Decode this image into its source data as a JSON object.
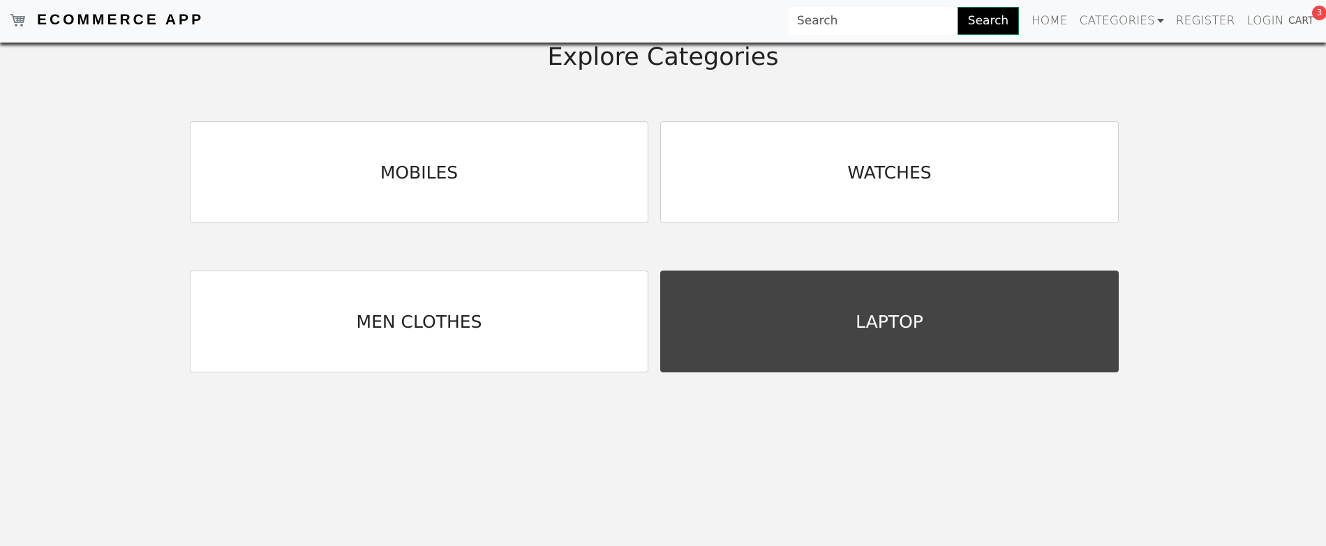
{
  "navbar": {
    "brand_icon": "shopping-cart-icon",
    "brand_text": "ECOMMERCE APP",
    "search": {
      "placeholder": "Search",
      "value": "",
      "button_label": "Search"
    },
    "links": {
      "home": "HOME",
      "categories": "CATEGORIES",
      "register": "REGISTER",
      "login": "LOGIN",
      "cart": "CART"
    },
    "cart_count": "3"
  },
  "main": {
    "title": "Explore Categories",
    "categories": [
      {
        "label": "MOBILES",
        "active": false
      },
      {
        "label": "WATCHES",
        "active": false
      },
      {
        "label": "MEN CLOTHES",
        "active": false
      },
      {
        "label": "LAPTOP",
        "active": true
      }
    ]
  },
  "colors": {
    "page_background": "#f3f3f3",
    "navbar_background": "#f8f9fa",
    "search_button": "#000000",
    "active_card": "#444444",
    "badge": "#f0474a"
  }
}
